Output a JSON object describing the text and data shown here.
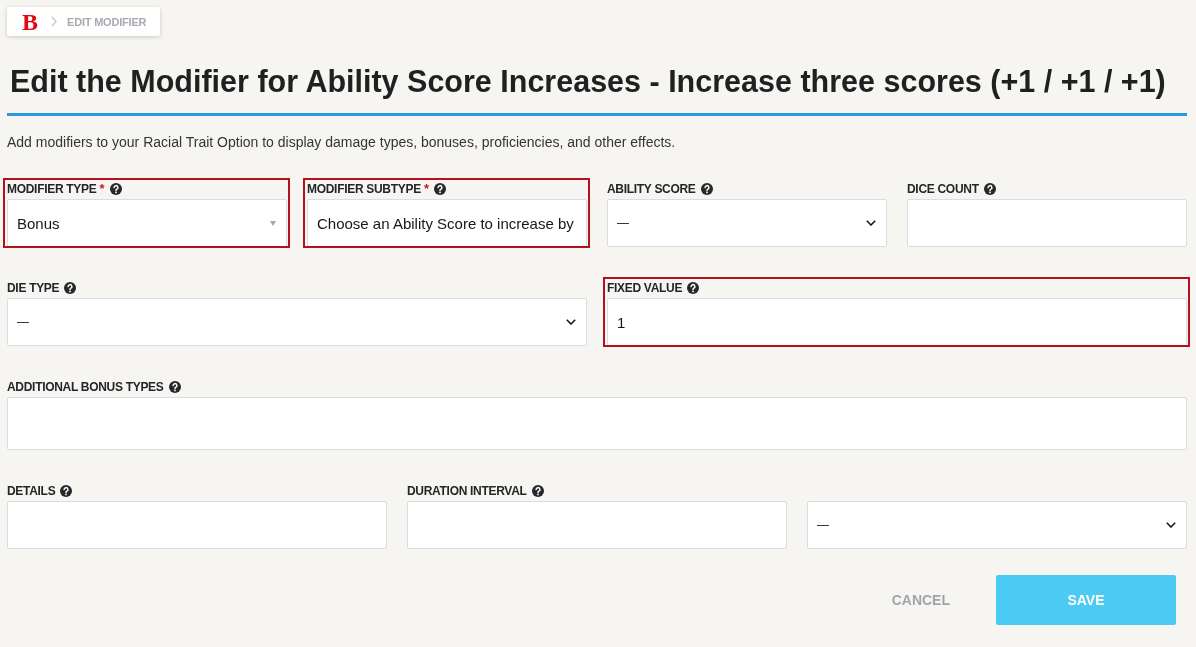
{
  "breadcrumb": {
    "logo": "B",
    "current": "EDIT MODIFIER"
  },
  "title": "Edit the Modifier for Ability Score Increases - Increase three scores (+1 / +1 / +1)",
  "description": "Add modifiers to your Racial Trait Option to display damage types, bonuses, proficiencies, and other effects.",
  "form_rows": [
    {
      "fields": [
        {
          "label": "MODIFIER TYPE",
          "required_mark": "*",
          "kind": "combo",
          "value": "Bonus",
          "highlighted": true
        },
        {
          "label": "MODIFIER SUBTYPE",
          "required_mark": "*",
          "kind": "display",
          "value": "Choose an Ability Score to increase by",
          "highlighted": true
        },
        {
          "label": "ABILITY SCORE",
          "kind": "select",
          "value": "—",
          "highlighted": false
        },
        {
          "label": "DICE COUNT",
          "kind": "input",
          "highlighted": false
        }
      ]
    },
    {
      "fields": [
        {
          "label": "DIE TYPE",
          "kind": "select",
          "value": "—",
          "highlighted": false
        },
        {
          "label": "FIXED VALUE",
          "kind": "input",
          "value": "1",
          "highlighted": true
        }
      ]
    },
    {
      "fields": [
        {
          "label": "ADDITIONAL BONUS TYPES",
          "kind": "multiselect",
          "highlighted": false
        }
      ]
    },
    {
      "fields": [
        {
          "label": "DETAILS",
          "kind": "input",
          "highlighted": false
        },
        {
          "label": "DURATION INTERVAL",
          "kind": "input",
          "highlighted": false
        },
        {
          "kind": "select",
          "value": "—",
          "highlighted": false
        }
      ]
    }
  ],
  "actions": {
    "cancel": "CANCEL",
    "save": "SAVE"
  }
}
